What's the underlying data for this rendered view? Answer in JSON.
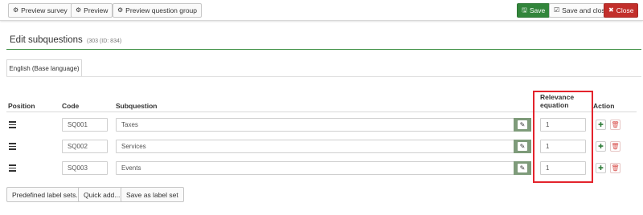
{
  "toolbar": {
    "preview_survey": "Preview survey",
    "preview": "Preview",
    "preview_question_group": "Preview question group",
    "save": "Save",
    "save_and_close": "Save and close",
    "close": "Close",
    "icons": {
      "preview": "gear-icon",
      "save": "floppy-disk-icon",
      "save_and_close": "check-square-icon",
      "close": "close-icon"
    }
  },
  "heading": {
    "title": "Edit subquestions",
    "subtitle": "(303 (ID: 834)"
  },
  "language_tab": {
    "label": "English (Base language)"
  },
  "table": {
    "headers": {
      "position": "Position",
      "code": "Code",
      "subquestion": "Subquestion",
      "relevance_line1": "Relevance",
      "relevance_line2": "equation",
      "action": "Action"
    },
    "rows": [
      {
        "code": "SQ001",
        "subquestion": "Taxes",
        "relevance": "1"
      },
      {
        "code": "SQ002",
        "subquestion": "Services",
        "relevance": "1"
      },
      {
        "code": "SQ003",
        "subquestion": "Events",
        "relevance": "1"
      }
    ]
  },
  "bottom_buttons": {
    "predefined": "Predefined label sets...",
    "quick_add": "Quick add...",
    "save_label_set": "Save as label set"
  },
  "colors": {
    "green": "#32853b",
    "red": "#c22f2b",
    "highlight": "#e3232c",
    "edit_button": "#7e9b7a"
  }
}
